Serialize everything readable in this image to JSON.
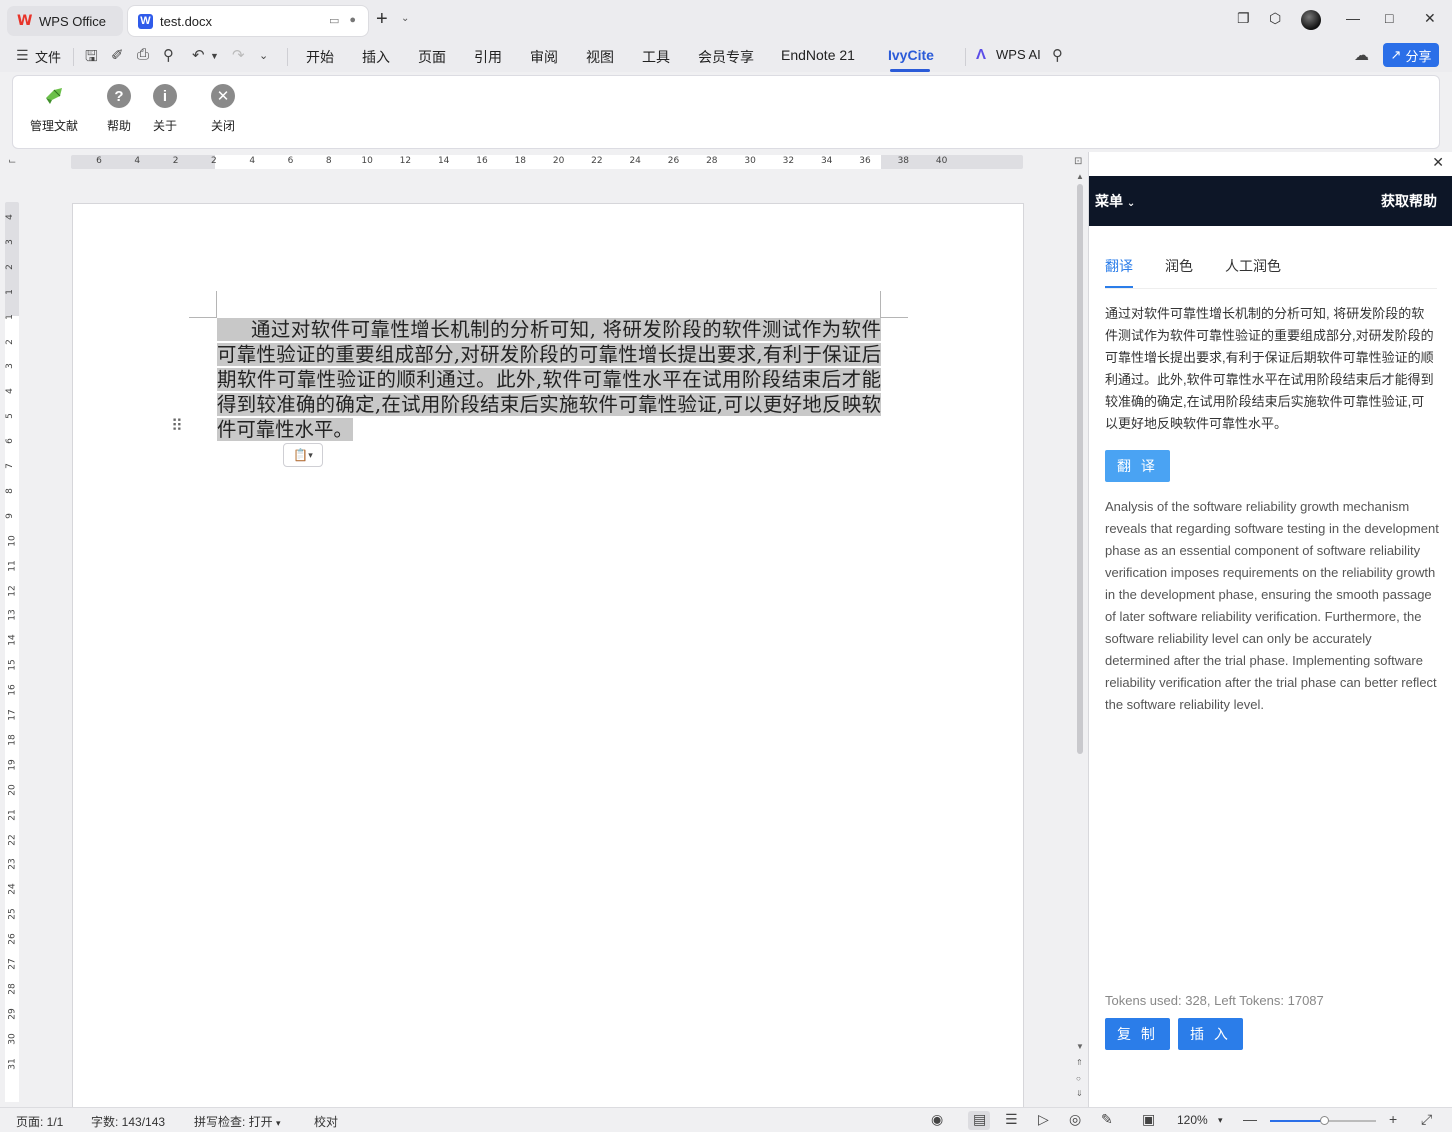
{
  "window": {
    "tabs": [
      {
        "label": "WPS Office"
      },
      {
        "label": "test.docx"
      }
    ]
  },
  "menubar": {
    "file_label": "文件",
    "items": [
      "开始",
      "插入",
      "页面",
      "引用",
      "审阅",
      "视图",
      "工具",
      "会员专享",
      "EndNote 21",
      "IvyCite"
    ],
    "active": "IvyCite",
    "wps_ai": "WPS AI",
    "share": "分享",
    "accent_color": "#2b5bd8"
  },
  "ribbon": {
    "buttons": [
      {
        "label": "管理文献",
        "icon": "leaf-icon"
      },
      {
        "label": "帮助",
        "icon": "question-icon"
      },
      {
        "label": "关于",
        "icon": "info-icon"
      },
      {
        "label": "关闭",
        "icon": "close-circle-icon"
      }
    ]
  },
  "ruler": {
    "horizontal": [
      "6",
      "4",
      "2",
      "2",
      "4",
      "6",
      "8",
      "10",
      "12",
      "14",
      "16",
      "18",
      "20",
      "22",
      "24",
      "26",
      "28",
      "30",
      "32",
      "34",
      "36",
      "38",
      "40"
    ],
    "vertical": [
      "4",
      "3",
      "2",
      "1",
      "1",
      "2",
      "3",
      "4",
      "5",
      "6",
      "7",
      "8",
      "9",
      "10",
      "11",
      "12",
      "13",
      "14",
      "15",
      "16",
      "17",
      "18",
      "19",
      "20",
      "21",
      "22",
      "23",
      "24",
      "25",
      "26",
      "27",
      "28",
      "29",
      "30",
      "31"
    ]
  },
  "document": {
    "paragraph": "通过对软件可靠性增长机制的分析可知, 将研发阶段的软件测试作为软件可靠性验证的重要组成部分,对研发阶段的可靠性增长提出要求,有利于保证后期软件可靠性验证的顺利通过。此外,软件可靠性水平在试用阶段结束后才能得到较准确的确定,在试用阶段结束后实施软件可靠性验证,可以更好地反映软件可靠性水平。"
  },
  "panel": {
    "menu_label": "菜单",
    "help_label": "获取帮助",
    "tabs": [
      "翻译",
      "润色",
      "人工润色"
    ],
    "active_tab": "翻译",
    "source_text": "通过对软件可靠性增长机制的分析可知, 将研发阶段的软件测试作为软件可靠性验证的重要组成部分,对研发阶段的可靠性增长提出要求,有利于保证后期软件可靠性验证的顺利通过。此外,软件可靠性水平在试用阶段结束后才能得到较准确的确定,在试用阶段结束后实施软件可靠性验证,可以更好地反映软件可靠性水平。",
    "translate_button": "翻 译",
    "output_text": "Analysis of the software reliability growth mechanism reveals that regarding software testing in the development phase as an essential component of software reliability verification imposes requirements on the reliability growth in the development phase, ensuring the smooth passage of later software reliability verification. Furthermore, the software reliability level can only be accurately determined after the trial phase. Implementing software reliability verification after the trial phase can better reflect the software reliability level.",
    "tokens": "Tokens used: 328, Left Tokens: 17087",
    "copy_button": "复 制",
    "insert_button": "插 入",
    "accent_color": "#2b7de9",
    "header_color": "#0d1627"
  },
  "statusbar": {
    "page": "页面: 1/1",
    "word_count": "字数: 143/143",
    "spell_check": "拼写检查: 打开",
    "proofread": "校对",
    "zoom": "120%",
    "zoom_slider_fraction": 0.52
  }
}
